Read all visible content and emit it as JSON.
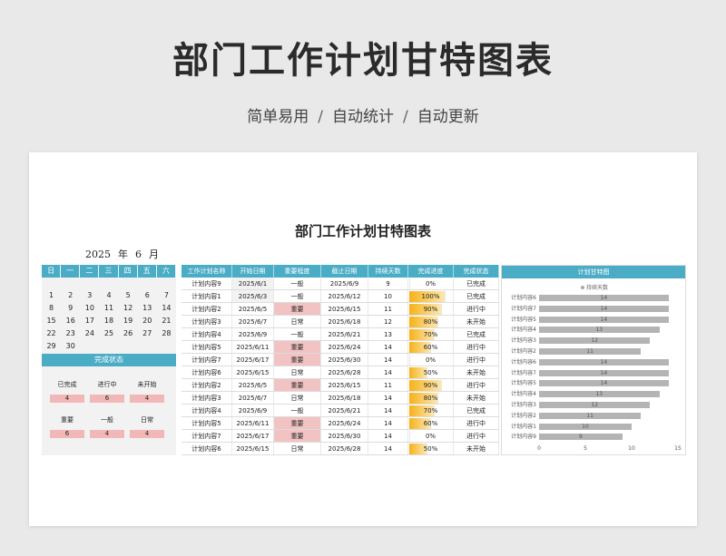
{
  "hero": {
    "title": "部门工作计划甘特图表",
    "sub": [
      "简单易用",
      "自动统计",
      "自动更新"
    ],
    "sep": "/"
  },
  "sheet": {
    "title": "部门工作计划甘特图表"
  },
  "calendar": {
    "year": "2025",
    "year_label": "年",
    "month": "6",
    "month_label": "月",
    "weekdays": [
      "日",
      "一",
      "二",
      "三",
      "四",
      "五",
      "六"
    ],
    "days": [
      "1",
      "2",
      "3",
      "4",
      "5",
      "6",
      "7",
      "8",
      "9",
      "10",
      "11",
      "12",
      "13",
      "14",
      "15",
      "16",
      "17",
      "18",
      "19",
      "20",
      "21",
      "22",
      "23",
      "24",
      "25",
      "26",
      "27",
      "28",
      "29",
      "30"
    ]
  },
  "status": {
    "title": "完成状态",
    "row1": [
      {
        "label": "已完成",
        "value": "4"
      },
      {
        "label": "进行中",
        "value": "6"
      },
      {
        "label": "未开始",
        "value": "4"
      }
    ],
    "row2": [
      {
        "label": "重要",
        "value": "6"
      },
      {
        "label": "一般",
        "value": "4"
      },
      {
        "label": "日常",
        "value": "4"
      }
    ]
  },
  "table": {
    "headers": [
      "工作计划名称",
      "开始日期",
      "重要程度",
      "截止日期",
      "持续天数",
      "完成进度",
      "完成状态"
    ],
    "rows": [
      [
        "计划内容9",
        "2025/6/1",
        "一般",
        "2025/6/9",
        "9",
        "0%",
        "已完成"
      ],
      [
        "计划内容1",
        "2025/6/3",
        "一般",
        "2025/6/12",
        "10",
        "100%",
        "已完成"
      ],
      [
        "计划内容2",
        "2025/6/5",
        "重要",
        "2025/6/15",
        "11",
        "90%",
        "进行中"
      ],
      [
        "计划内容3",
        "2025/6/7",
        "日常",
        "2025/6/18",
        "12",
        "80%",
        "未开始"
      ],
      [
        "计划内容4",
        "2025/6/9",
        "一般",
        "2025/6/21",
        "13",
        "70%",
        "已完成"
      ],
      [
        "计划内容5",
        "2025/6/11",
        "重要",
        "2025/6/24",
        "14",
        "60%",
        "进行中"
      ],
      [
        "计划内容7",
        "2025/6/17",
        "重要",
        "2025/6/30",
        "14",
        "0%",
        "进行中"
      ],
      [
        "计划内容6",
        "2025/6/15",
        "日常",
        "2025/6/28",
        "14",
        "50%",
        "未开始"
      ],
      [
        "计划内容2",
        "2025/6/5",
        "重要",
        "2025/6/15",
        "11",
        "90%",
        "进行中"
      ],
      [
        "计划内容3",
        "2025/6/7",
        "日常",
        "2025/6/18",
        "14",
        "80%",
        "未开始"
      ],
      [
        "计划内容4",
        "2025/6/9",
        "一般",
        "2025/6/21",
        "14",
        "70%",
        "已完成"
      ],
      [
        "计划内容5",
        "2025/6/11",
        "重要",
        "2025/6/24",
        "14",
        "60%",
        "进行中"
      ],
      [
        "计划内容7",
        "2025/6/17",
        "重要",
        "2025/6/30",
        "14",
        "0%",
        "进行中"
      ],
      [
        "计划内容6",
        "2025/6/15",
        "日常",
        "2025/6/28",
        "14",
        "50%",
        "未开始"
      ]
    ],
    "progress": [
      0,
      1.0,
      0.9,
      0.8,
      0.7,
      0.6,
      0,
      0.5,
      0.9,
      0.8,
      0.7,
      0.6,
      0,
      0.5
    ]
  },
  "gantt": {
    "title": "计划甘特图",
    "legend": "持续天数",
    "labels": [
      "计划内容6",
      "计划内容7",
      "计划内容5",
      "计划内容4",
      "计划内容3",
      "计划内容2",
      "计划内容6",
      "计划内容7",
      "计划内容5",
      "计划内容4",
      "计划内容3",
      "计划内容2",
      "计划内容1",
      "计划内容9"
    ],
    "values": [
      "14",
      "14",
      "14",
      "13",
      "12",
      "11",
      "14",
      "14",
      "14",
      "13",
      "12",
      "11",
      "10",
      "9"
    ],
    "ticks": [
      "0",
      "5",
      "10",
      "15"
    ],
    "xmax": 15
  }
}
